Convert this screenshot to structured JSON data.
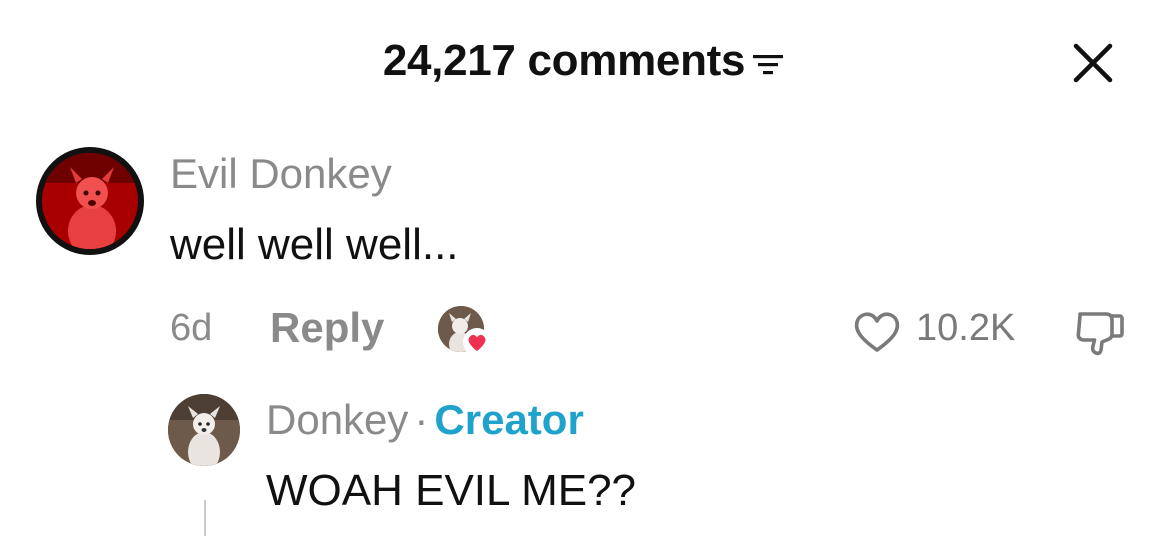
{
  "header": {
    "title": "24,217 comments",
    "filter_icon": "filter-lines-icon",
    "close_icon": "close-x-icon"
  },
  "comments": [
    {
      "username": "Evil Donkey",
      "text": "well well well...",
      "time": "6d",
      "reply_label": "Reply",
      "likes": "10.2K",
      "liked_by_creator": true,
      "avatar": "red-chihuahua-avatar"
    },
    {
      "username": "Donkey",
      "separator": "·",
      "badge": "Creator",
      "text": "WOAH EVIL ME??",
      "avatar": "white-chihuahua-avatar"
    }
  ],
  "colors": {
    "creator_badge": "#1fa2cc",
    "muted_text": "#8a8a8a",
    "heart": "#f0304f"
  }
}
